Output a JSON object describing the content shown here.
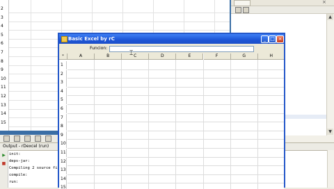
{
  "background_sheet": {
    "row_numbers": [
      "2",
      "3",
      "4",
      "5",
      "6",
      "7",
      "8",
      "9",
      "10",
      "11",
      "12",
      "13",
      "14",
      "15"
    ]
  },
  "ide_right": {
    "tab_close": "×",
    "scroll_up": "▲",
    "scroll_down": "▼"
  },
  "output": {
    "title": "Output - rDexcel (run)",
    "lines": [
      "init:",
      "deps-jar:",
      "Compiling 2 source fi",
      "compile:",
      "run:"
    ]
  },
  "app_window": {
    "title": "Basic Excel by rC",
    "min_symbol": "_",
    "max_symbol": "□",
    "close_symbol": "×",
    "function_label": "Funcion:",
    "function_value": "",
    "corner_symbol": "*",
    "columns": [
      "A",
      "B",
      "C",
      "D",
      "E",
      "F",
      "G",
      "H"
    ],
    "rows": [
      "1",
      "2",
      "3",
      "4",
      "5",
      "6",
      "7",
      "8",
      "9",
      "10",
      "11",
      "12",
      "13",
      "14",
      "15"
    ]
  },
  "colors": {
    "titlebar": "#2457c9",
    "window_face": "#ece9d8",
    "grid_lines": "#dcdcdc"
  }
}
